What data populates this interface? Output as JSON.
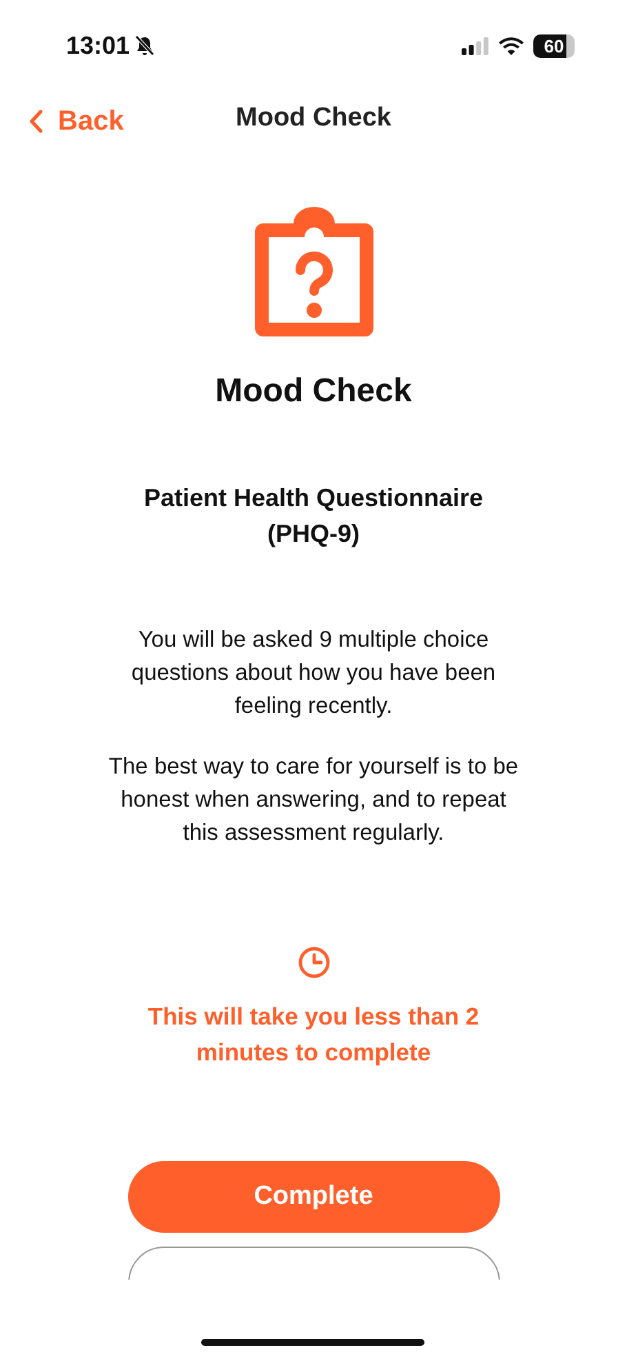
{
  "status_bar": {
    "time": "13:01",
    "battery": "60"
  },
  "nav": {
    "back": "Back",
    "title": "Mood Check"
  },
  "heading": "Mood Check",
  "subtitle": "Patient Health Questionnaire (PHQ-9)",
  "paragraphs": [
    "You will be asked 9 multiple choice questions about how you have been feeling recently.",
    "The best way to care for yourself is to be honest when answering, and to repeat this assessment regularly."
  ],
  "duration": "This will take you less than 2 minutes to complete",
  "buttons": [
    {
      "kind": "primary",
      "label": "Complete"
    },
    {
      "kind": "outline"
    }
  ]
}
